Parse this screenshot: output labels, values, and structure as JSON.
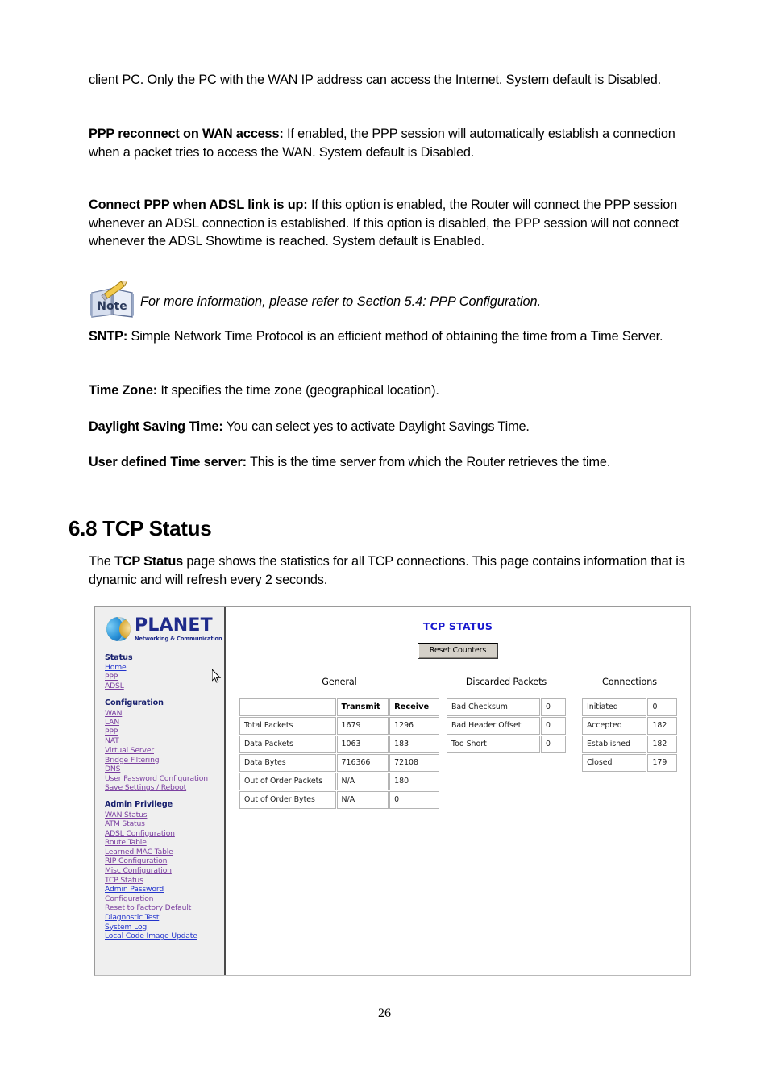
{
  "document": {
    "paragraphs": [
      {
        "id": "p-client-pc",
        "text": "client PC. Only the PC with the WAN IP address can access the Internet. System default is Disabled."
      },
      {
        "id": "p-ppp-reconnect",
        "bold_lead": "PPP reconnect on WAN access:",
        "text": " If enabled, the PPP session will automatically establish a connection when a packet tries to access the WAN. System default is Disabled."
      },
      {
        "id": "p-connect-ppp",
        "bold_lead": "Connect PPP when ADSL link is up:",
        "text": " If this option is enabled, the Router will connect the PPP session whenever an ADSL connection is established. If this option is disabled, the PPP session will not connect whenever the ADSL Showtime is reached. System default is Enabled."
      },
      {
        "id": "p-sntp",
        "bold_lead": "SNTP:",
        "text": " Simple Network Time Protocol is an efficient method of obtaining the time from a Time Server."
      },
      {
        "id": "p-time-zone",
        "bold_lead": "Time Zone:",
        "text": " It specifies the time zone (geographical location)."
      },
      {
        "id": "p-daylight",
        "bold_lead": "Daylight Saving Time:",
        "text": " You can select yes to activate Daylight Savings Time."
      },
      {
        "id": "p-time-server",
        "bold_lead": "User defined Time server:",
        "text": " This is the time server from which the Router retrieves the time."
      }
    ],
    "note": {
      "icon_label": "Note",
      "text": "For more information, please refer to Section 5.4: PPP Configuration."
    },
    "heading": "6.8 TCP Status",
    "intro": {
      "part1": "The ",
      "bold": "TCP Status",
      "part2": " page shows the statistics for all TCP connections. This page contains information that is dynamic and will refresh every 2 seconds."
    },
    "page_number": "26"
  },
  "screenshot": {
    "logo": {
      "name": "PLANET",
      "tagline": "Networking & Communication"
    },
    "sidebar": {
      "groups": [
        {
          "heading": "Status",
          "items": [
            {
              "label": "Home",
              "color": "blue"
            },
            {
              "label": "PPP",
              "color": "purple"
            },
            {
              "label": "ADSL",
              "color": "purple"
            }
          ]
        },
        {
          "heading": "Configuration",
          "items": [
            {
              "label": "WAN",
              "color": "purple"
            },
            {
              "label": "LAN",
              "color": "purple"
            },
            {
              "label": "PPP",
              "color": "purple"
            },
            {
              "label": "NAT",
              "color": "purple"
            },
            {
              "label": "Virtual Server",
              "color": "purple"
            },
            {
              "label": "Bridge Filtering",
              "color": "purple"
            },
            {
              "label": "DNS",
              "color": "purple"
            },
            {
              "label": "User Password Configuration",
              "color": "purple"
            },
            {
              "label": "Save Settings / Reboot",
              "color": "purple"
            }
          ]
        },
        {
          "heading": "Admin Privilege",
          "items": [
            {
              "label": "WAN Status",
              "color": "purple"
            },
            {
              "label": "ATM Status",
              "color": "purple"
            },
            {
              "label": "ADSL Configuration",
              "color": "purple"
            },
            {
              "label": "Route Table",
              "color": "purple"
            },
            {
              "label": "Learned MAC Table",
              "color": "purple"
            },
            {
              "label": "RIP Configuration",
              "color": "purple"
            },
            {
              "label": "Misc Configuration",
              "color": "purple"
            },
            {
              "label": "TCP Status",
              "color": "purple"
            },
            {
              "label": "Admin Password",
              "color": "blue"
            },
            {
              "label": "Configuration",
              "color": "purple"
            },
            {
              "label": "Reset to Factory Default",
              "color": "purple"
            },
            {
              "label": "Diagnostic Test",
              "color": "blue"
            },
            {
              "label": "System Log",
              "color": "blue"
            },
            {
              "label": "Local Code Image Update",
              "color": "blue"
            }
          ]
        }
      ]
    },
    "page_title": "TCP STATUS",
    "reset_button": "Reset Counters",
    "tables": {
      "general": {
        "caption": "General",
        "columns": [
          "",
          "Transmit",
          "Receive"
        ],
        "rows": [
          {
            "label": "Total Packets",
            "transmit": "1679",
            "receive": "1296"
          },
          {
            "label": "Data Packets",
            "transmit": "1063",
            "receive": "183"
          },
          {
            "label": "Data Bytes",
            "transmit": "716366",
            "receive": "72108"
          },
          {
            "label": "Out of Order Packets",
            "transmit": "N/A",
            "receive": "180"
          },
          {
            "label": "Out of Order Bytes",
            "transmit": "N/A",
            "receive": "0"
          }
        ]
      },
      "discarded": {
        "caption": "Discarded Packets",
        "rows": [
          {
            "label": "Bad Checksum",
            "value": "0"
          },
          {
            "label": "Bad Header Offset",
            "value": "0"
          },
          {
            "label": "Too Short",
            "value": "0"
          }
        ]
      },
      "connections": {
        "caption": "Connections",
        "rows": [
          {
            "label": "Initiated",
            "value": "0"
          },
          {
            "label": "Accepted",
            "value": "182"
          },
          {
            "label": "Established",
            "value": "182"
          },
          {
            "label": "Closed",
            "value": "179"
          }
        ]
      }
    }
  },
  "colors": {
    "link_purple": "#7b3fa0",
    "link_blue": "#2233cc",
    "heading_navy": "#18206e",
    "title_blue": "#1919cf",
    "logo_navy": "#1e2a8a",
    "sidebar_bg": "#efefef",
    "button_face": "#d4d0c8"
  }
}
